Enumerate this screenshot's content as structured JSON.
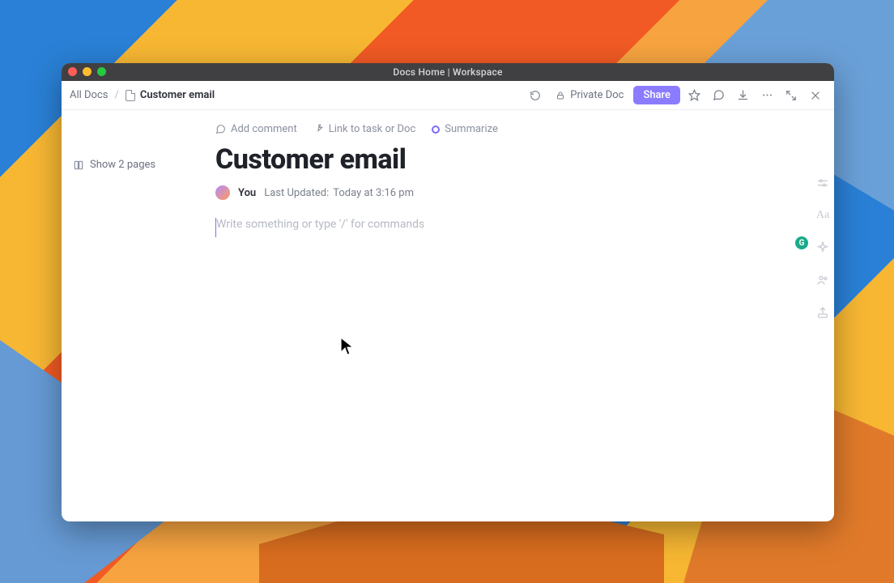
{
  "window": {
    "title": "Docs Home | Workspace"
  },
  "breadcrumb": {
    "root": "All Docs",
    "current": "Customer email"
  },
  "toolbar": {
    "private_label": "Private Doc",
    "share_label": "Share"
  },
  "sidebar": {
    "show_pages_label": "Show 2 pages"
  },
  "doc": {
    "actions": {
      "add_comment": "Add comment",
      "link_task": "Link to task or Doc",
      "summarize": "Summarize"
    },
    "title": "Customer email",
    "author": "You",
    "last_updated_label": "Last Updated:",
    "last_updated_value": "Today at 3:16 pm",
    "editor_placeholder": "Write something or type '/' for commands"
  },
  "ai_badge": "G"
}
